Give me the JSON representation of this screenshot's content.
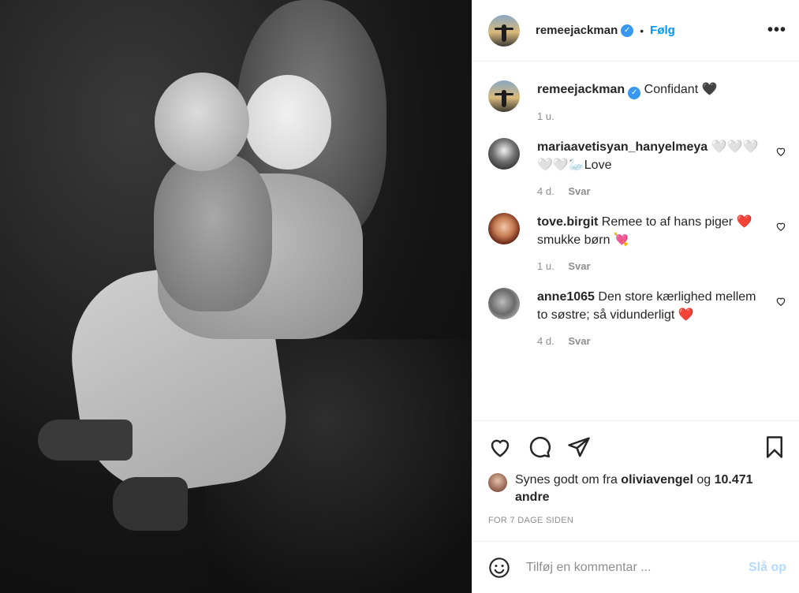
{
  "post": {
    "author": "remeejackman",
    "follow_label": "Følg",
    "dot": "•",
    "more_label": "•••",
    "verified_mark": "✓",
    "caption_author": "remeejackman",
    "caption_text": "Confidant 🖤",
    "caption_time": "1 u."
  },
  "comments": [
    {
      "author": "mariaavetisyan_hanyelmeya",
      "text": "🤍🤍🤍🤍🤍🦢Love",
      "time": "4 d.",
      "reply": "Svar"
    },
    {
      "author": "tove.birgit",
      "text": "Remee to af hans piger ❤️smukke børn 💘",
      "time": "1 u.",
      "reply": "Svar"
    },
    {
      "author": "anne1065",
      "text": "Den store kærlighed mellem to søstre; så vidunderligt ❤️",
      "time": "4 d.",
      "reply": "Svar"
    }
  ],
  "likes": {
    "prefix": "Synes godt om fra",
    "user": "oliviavengel",
    "connector": "og",
    "count": "10.471 andre"
  },
  "timestamp": "FOR 7 DAGE SIDEN",
  "add_comment": {
    "placeholder": "Tilføj en kommentar ...",
    "post_label": "Slå op"
  },
  "icons": {
    "like": "heart-icon",
    "comment": "comment-icon",
    "share": "paper-plane-icon",
    "save": "bookmark-icon",
    "emoji": "smiley-icon"
  },
  "colors": {
    "accent": "#0095f6",
    "verified": "#3897f0",
    "muted": "#8e8e8e",
    "post_disabled": "#b3dbff"
  }
}
